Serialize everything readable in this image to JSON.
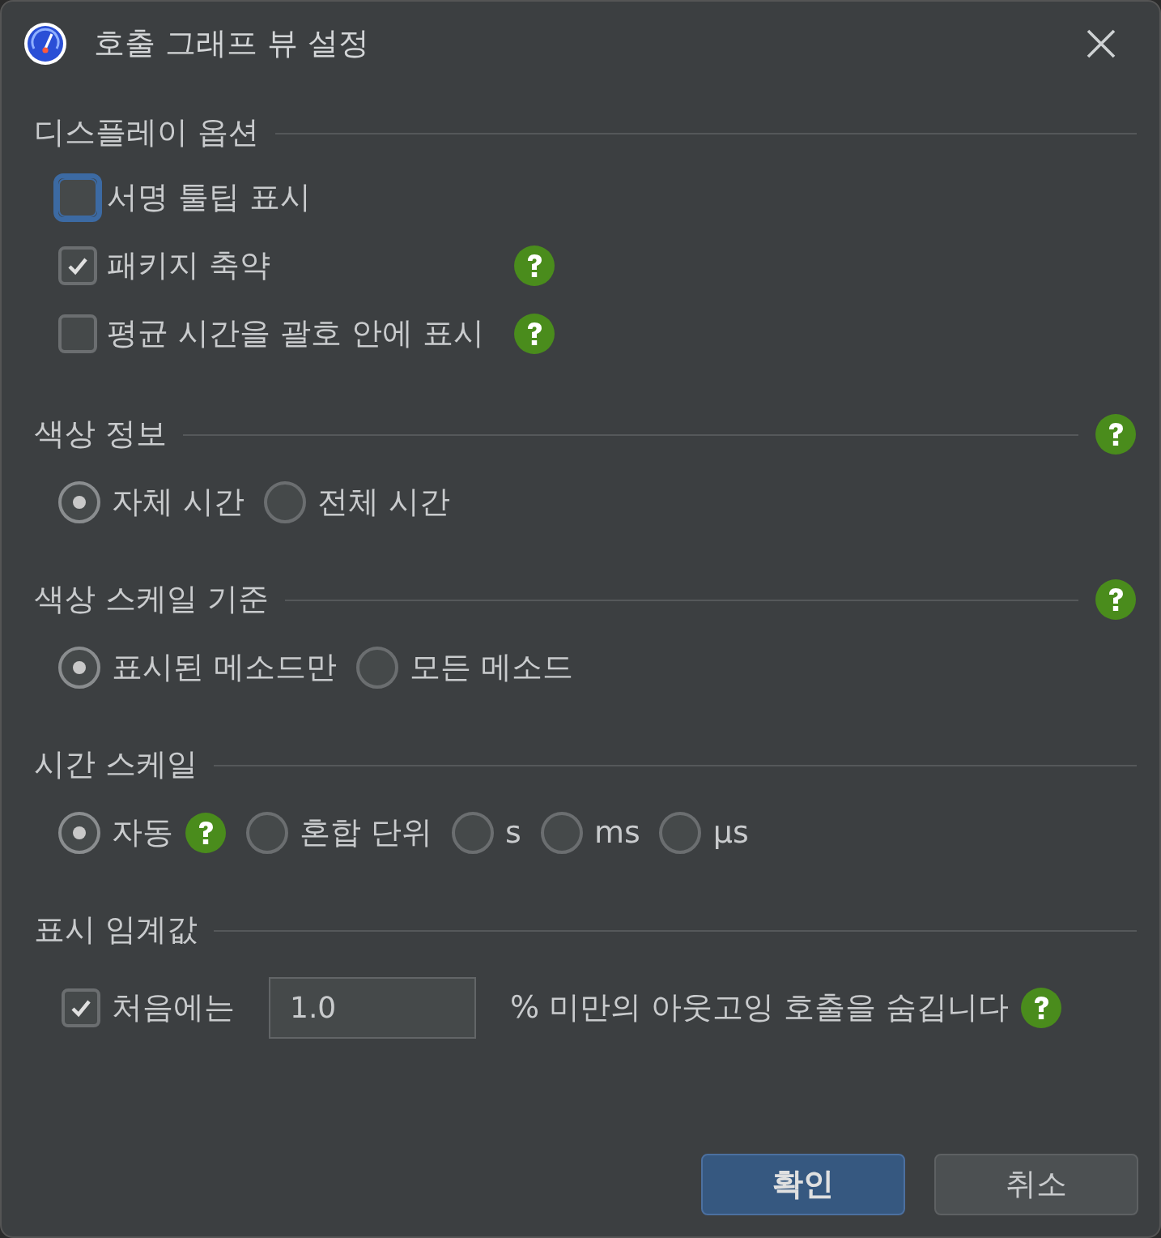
{
  "window": {
    "title": "호출 그래프 뷰 설정"
  },
  "sections": [
    {
      "title": "디스플레이 옵션",
      "help": false,
      "kind": "checkboxes",
      "items": [
        {
          "label": "서명 툴팁 표시",
          "checked": false,
          "focused": true,
          "help": false
        },
        {
          "label": "패키지 축약",
          "checked": true,
          "focused": false,
          "help": true
        },
        {
          "label": "평균 시간을 괄호 안에 표시",
          "checked": false,
          "focused": false,
          "help": true
        }
      ]
    },
    {
      "title": "색상 정보",
      "help": true,
      "kind": "radios",
      "options": [
        {
          "label": "자체 시간",
          "selected": true,
          "help": false
        },
        {
          "label": "전체 시간",
          "selected": false,
          "help": false
        }
      ]
    },
    {
      "title": "색상 스케일 기준",
      "help": true,
      "kind": "radios",
      "options": [
        {
          "label": "표시된 메소드만",
          "selected": true,
          "help": false
        },
        {
          "label": "모든 메소드",
          "selected": false,
          "help": false
        }
      ]
    },
    {
      "title": "시간 스케일",
      "help": false,
      "kind": "radios",
      "options": [
        {
          "label": "자동",
          "selected": true,
          "help": true
        },
        {
          "label": "혼합 단위",
          "selected": false,
          "help": false
        },
        {
          "label": "s",
          "selected": false,
          "help": false
        },
        {
          "label": "ms",
          "selected": false,
          "help": false
        },
        {
          "label": "µs",
          "selected": false,
          "help": false
        }
      ]
    },
    {
      "title": "표시 임계값",
      "help": false,
      "kind": "threshold",
      "checked": true,
      "prefix": "처음에는",
      "value": "1.0",
      "suffix": "% 미만의 아웃고잉 호출을 숨깁니다",
      "suffix_help": true
    }
  ],
  "buttons": [
    {
      "label": "확인",
      "primary": true
    },
    {
      "label": "취소",
      "primary": false
    }
  ]
}
